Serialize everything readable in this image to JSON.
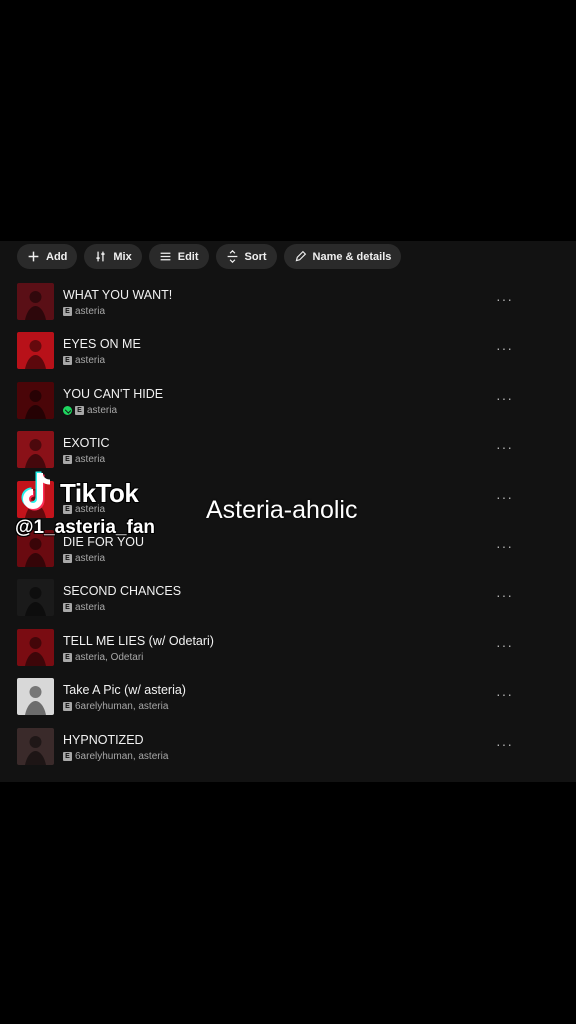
{
  "toolbar": {
    "add_label": "Add",
    "mix_label": "Mix",
    "edit_label": "Edit",
    "sort_label": "Sort",
    "name_label": "Name & details"
  },
  "tracks": [
    {
      "title": "WHAT YOU WANT!",
      "artists": "asteria",
      "downloaded": false,
      "art_color": "#5a0f16"
    },
    {
      "title": "EYES ON ME",
      "artists": "asteria",
      "downloaded": false,
      "art_color": "#b81119"
    },
    {
      "title": "YOU CAN'T HIDE",
      "artists": "asteria",
      "downloaded": true,
      "art_color": "#4a0508"
    },
    {
      "title": "EXOTIC",
      "artists": "asteria",
      "downloaded": false,
      "art_color": "#8a1118"
    },
    {
      "title": "",
      "artists": "asteria",
      "downloaded": false,
      "art_color": "#c3131b"
    },
    {
      "title": "DIE FOR YOU",
      "artists": "asteria",
      "downloaded": false,
      "art_color": "#6a0a10"
    },
    {
      "title": "SECOND CHANCES",
      "artists": "asteria",
      "downloaded": false,
      "art_color": "#1a1a1a"
    },
    {
      "title": "TELL ME LIES (w/ Odetari)",
      "artists": "asteria, Odetari",
      "downloaded": false,
      "art_color": "#7a0c12"
    },
    {
      "title": "Take A Pic (w/ asteria)",
      "artists": "6arelyhuman, asteria",
      "downloaded": false,
      "art_color": "#d8d8d8"
    },
    {
      "title": "HYPNOTIZED",
      "artists": "6arelyhuman, asteria",
      "downloaded": false,
      "art_color": "#3a2a2a"
    }
  ],
  "explicit_badge": "E",
  "more_glyph": "···",
  "overlay": {
    "tiktok_word": "TikTok",
    "tiktok_handle": "@1_asteria_fan",
    "caption": "Asteria-aholic"
  }
}
